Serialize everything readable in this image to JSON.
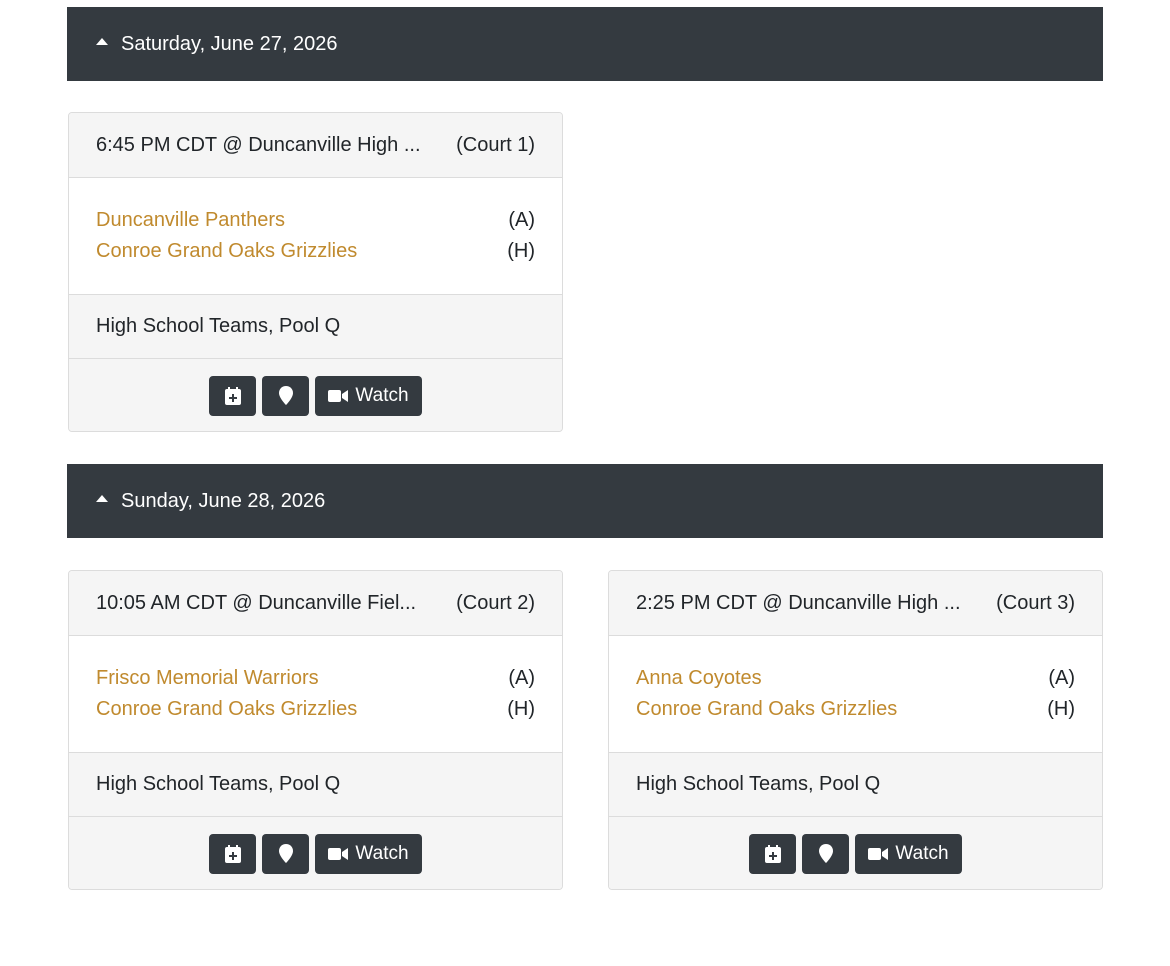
{
  "days": [
    {
      "label": "Saturday, June 27, 2026",
      "games": [
        {
          "time_location": "6:45 PM CDT @ Duncanville High ...",
          "court": "(Court 1)",
          "away_team": "Duncanville Panthers",
          "away_tag": "(A)",
          "home_team": "Conroe Grand Oaks Grizzlies",
          "home_tag": "(H)",
          "pool": "High School Teams, Pool Q",
          "watch_label": "Watch"
        }
      ]
    },
    {
      "label": "Sunday, June 28, 2026",
      "games": [
        {
          "time_location": "10:05 AM CDT @ Duncanville Fiel...",
          "court": "(Court 2)",
          "away_team": "Frisco Memorial Warriors",
          "away_tag": "(A)",
          "home_team": "Conroe Grand Oaks Grizzlies",
          "home_tag": "(H)",
          "pool": "High School Teams, Pool Q",
          "watch_label": "Watch"
        },
        {
          "time_location": "2:25 PM CDT @ Duncanville High ...",
          "court": "(Court 3)",
          "away_team": "Anna Coyotes",
          "away_tag": "(A)",
          "home_team": "Conroe Grand Oaks Grizzlies",
          "home_tag": "(H)",
          "pool": "High School Teams, Pool Q",
          "watch_label": "Watch"
        }
      ]
    }
  ],
  "icons": {
    "collapse": "caret-up-icon",
    "calendar": "calendar-plus-icon",
    "map": "map-marker-icon",
    "video": "video-camera-icon"
  },
  "colors": {
    "header_bg": "#343a40",
    "team_link": "#c08a2e",
    "card_muted_bg": "#f5f5f5"
  }
}
